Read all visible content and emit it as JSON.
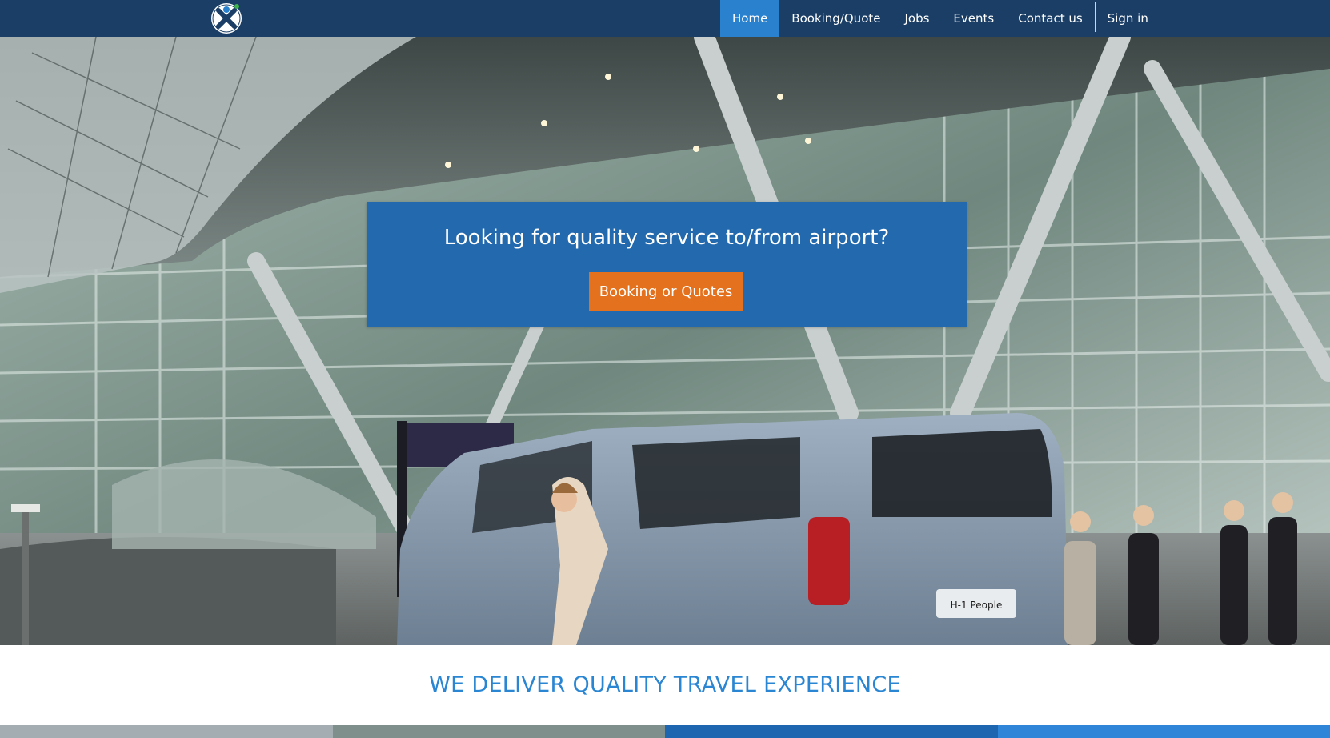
{
  "nav": {
    "items": [
      {
        "label": "Home",
        "active": true
      },
      {
        "label": "Booking/Quote",
        "active": false
      },
      {
        "label": "Jobs",
        "active": false
      },
      {
        "label": "Events",
        "active": false
      },
      {
        "label": "Contact us",
        "active": false
      }
    ],
    "signin_label": "Sign in"
  },
  "hero": {
    "heading": "Looking for quality service to/from airport?",
    "button_label": "Booking or Quotes",
    "van_plate": "H-1 People"
  },
  "tagline": "WE DELIVER QUALITY TRAVEL EXPERIENCE",
  "colors": {
    "nav_bg": "#1a3e66",
    "nav_active": "#2a82cf",
    "cta_box": "#2369ad",
    "cta_button": "#e4711d",
    "tagline": "#2a86d2",
    "stripes": [
      "#a4adb2",
      "#7f8f8c",
      "#1f66b0",
      "#2f86d8"
    ]
  },
  "icons": {
    "logo": "x-person-logo-icon"
  }
}
